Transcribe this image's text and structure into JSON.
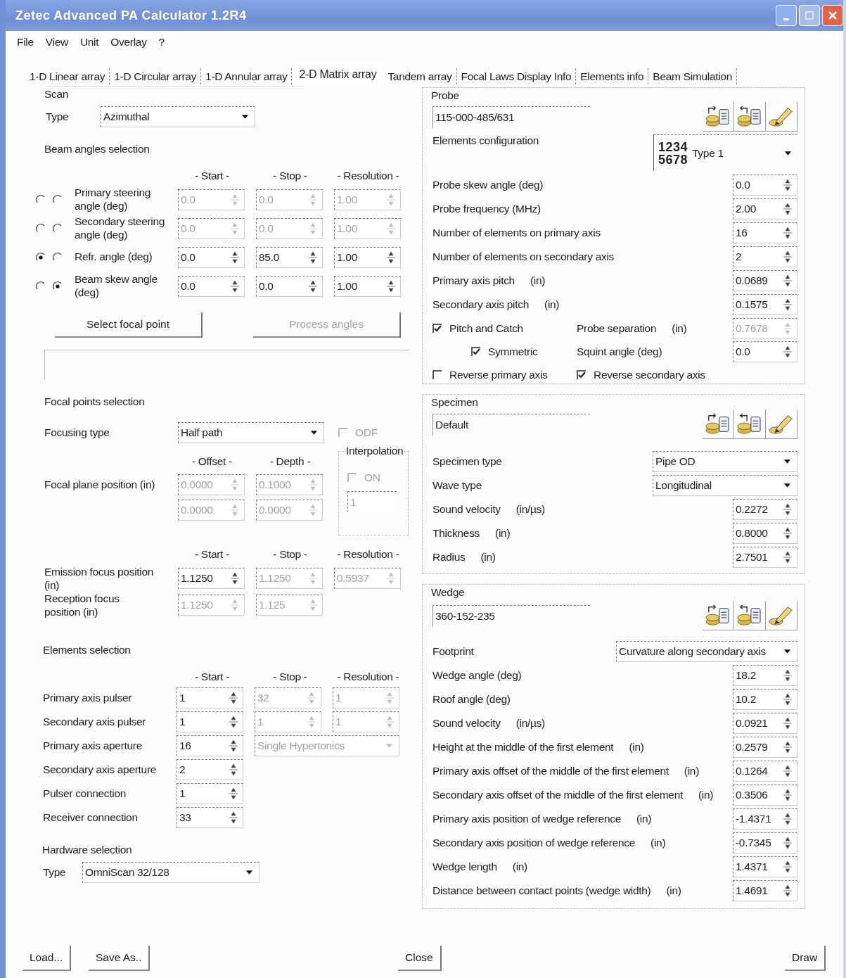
{
  "window": {
    "title": "Zetec Advanced PA Calculator 1.2R4"
  },
  "menu": [
    "File",
    "View",
    "Unit",
    "Overlay",
    "?"
  ],
  "tabs": [
    {
      "label": "1-D Linear array",
      "selected": false
    },
    {
      "label": "1-D Circular array",
      "selected": false
    },
    {
      "label": "1-D Annular array",
      "selected": false
    },
    {
      "label": "2-D Matrix array",
      "selected": true
    },
    {
      "label": "Tandem array",
      "selected": false
    },
    {
      "label": "Focal Laws Display Info",
      "selected": false
    },
    {
      "label": "Elements info",
      "selected": false
    },
    {
      "label": "Beam Simulation",
      "selected": false
    }
  ],
  "scan": {
    "title": "Scan",
    "type_label": "Type",
    "type": {
      "value": "Azimuthal",
      "disabled": false
    },
    "beam_angles_title": "Beam angles selection",
    "columns": [
      "- Start -",
      "- Stop -",
      "- Resolution -"
    ],
    "rows": [
      {
        "label": "Primary steering angle (deg)",
        "radios": [
          {
            "selected": false
          },
          {
            "selected": false
          }
        ],
        "fields": [
          {
            "value": "0.0",
            "disabled": true
          },
          {
            "value": "0.0",
            "disabled": true
          },
          {
            "value": "1.00",
            "disabled": true
          }
        ]
      },
      {
        "label": "Secondary steering angle (deg)",
        "radios": [
          {
            "selected": false
          },
          {
            "selected": false
          }
        ],
        "fields": [
          {
            "value": "0.0",
            "disabled": true
          },
          {
            "value": "0.0",
            "disabled": true
          },
          {
            "value": "1.00",
            "disabled": true
          }
        ]
      },
      {
        "label": "Refr. angle (deg)",
        "radios": [
          {
            "selected": true
          },
          {
            "selected": false
          }
        ],
        "fields": [
          {
            "value": "0.0",
            "disabled": false
          },
          {
            "value": "85.0",
            "disabled": false
          },
          {
            "value": "1.00",
            "disabled": false
          }
        ]
      },
      {
        "label": "Beam skew angle (deg)",
        "radios": [
          {
            "selected": false
          },
          {
            "selected": true
          }
        ],
        "fields": [
          {
            "value": "0.0",
            "disabled": false
          },
          {
            "value": "0.0",
            "disabled": false
          },
          {
            "value": "1.00",
            "disabled": false
          }
        ]
      }
    ],
    "buttons": [
      {
        "label": "Select focal point",
        "disabled": false
      },
      {
        "label": "Process angles",
        "disabled": true
      }
    ]
  },
  "focal": {
    "title": "Focal points selection",
    "focusing_type_label": "Focusing type",
    "focusing_type": {
      "value": "Half path",
      "disabled": false
    },
    "odf": {
      "label": "ODF",
      "checked": false,
      "disabled": true
    },
    "interpolation": {
      "title": "Interpolation",
      "on": {
        "label": "ON",
        "checked": false,
        "disabled": true
      },
      "value": {
        "value": "1",
        "disabled": true
      }
    },
    "plane_columns": [
      "- Offset -",
      "- Depth -"
    ],
    "plane_label": "Focal plane position (in)",
    "plane_rows": [
      [
        {
          "value": "0.0000",
          "disabled": true
        },
        {
          "value": "0.1000",
          "disabled": true
        }
      ],
      [
        {
          "value": "0.0000",
          "disabled": true
        },
        {
          "value": "0.0000",
          "disabled": true
        }
      ]
    ],
    "columns": [
      "- Start -",
      "- Stop -",
      "- Resolution -"
    ],
    "rows": [
      {
        "label": "Emission focus position (in)",
        "fields": [
          {
            "value": "1.1250",
            "disabled": false
          },
          {
            "value": "1.1250",
            "disabled": true
          },
          {
            "value": "0.5937",
            "disabled": true
          }
        ]
      },
      {
        "label": "Reception focus position (in)",
        "fields": [
          {
            "value": "1.1250",
            "disabled": true
          },
          {
            "value": "1.125",
            "disabled": true
          }
        ]
      }
    ]
  },
  "elements": {
    "title": "Elements selection",
    "columns": [
      "- Start -",
      "- Stop -",
      "- Resolution -"
    ],
    "rows": [
      {
        "label": "Primary axis pulser",
        "items": [
          {
            "kind": "spin",
            "value": "1",
            "disabled": false
          },
          {
            "kind": "spin",
            "value": "32",
            "disabled": true
          },
          {
            "kind": "spin",
            "value": "1",
            "disabled": true
          }
        ]
      },
      {
        "label": "Secondary axis pulser",
        "items": [
          {
            "kind": "spin",
            "value": "1",
            "disabled": false
          },
          {
            "kind": "spin",
            "value": "1",
            "disabled": true
          },
          {
            "kind": "spin",
            "value": "1",
            "disabled": true
          }
        ]
      },
      {
        "label": "Primary axis aperture",
        "items": [
          {
            "kind": "spin",
            "value": "16",
            "disabled": false
          },
          {
            "kind": "dropdown",
            "value": "Single Hypertonics",
            "disabled": true
          }
        ]
      },
      {
        "label": "Secondary axis aperture",
        "items": [
          {
            "kind": "spin",
            "value": "2",
            "disabled": false
          }
        ]
      },
      {
        "label": "Pulser connection",
        "items": [
          {
            "kind": "spin",
            "value": "1",
            "disabled": false
          }
        ]
      },
      {
        "label": "Receiver connection",
        "items": [
          {
            "kind": "spin",
            "value": "33",
            "disabled": false
          }
        ]
      }
    ]
  },
  "hardware": {
    "title": "Hardware selection",
    "type_label": "Type",
    "type": {
      "value": "OmniScan 32/128",
      "disabled": false
    }
  },
  "probe": {
    "title": "Probe",
    "name": "115-000-485/631",
    "config_label": "Elements configuration",
    "config": {
      "icon_lines": [
        "1234",
        "5678"
      ],
      "value": "Type 1"
    },
    "rows": [
      {
        "label": "Probe skew angle (deg)",
        "value": "0.0",
        "disabled": false
      },
      {
        "label": "Probe frequency (MHz)",
        "value": "2.00",
        "disabled": false
      },
      {
        "label": "Number of elements on primary axis",
        "value": "16",
        "disabled": false
      },
      {
        "label": "Number of elements on secondary axis",
        "value": "2",
        "disabled": false
      },
      {
        "label": "Primary axis pitch",
        "unit": "(in)",
        "value": "0.0689",
        "disabled": false
      },
      {
        "label": "Secondary axis pitch",
        "unit": "(in)",
        "value": "0.1575",
        "disabled": false
      }
    ],
    "pitch_catch": {
      "label": "Pitch and Catch",
      "checked": true
    },
    "separation": {
      "label": "Probe separation",
      "unit": "(in)",
      "value": "0.7678",
      "disabled": true
    },
    "symmetric": {
      "label": "Symmetric",
      "checked": true
    },
    "squint": {
      "label": "Squint angle (deg)",
      "value": "0.0",
      "disabled": false
    },
    "reverse_primary": {
      "label": "Reverse primary axis",
      "checked": false
    },
    "reverse_secondary": {
      "label": "Reverse secondary axis",
      "checked": true
    }
  },
  "specimen": {
    "title": "Specimen",
    "name": "Default",
    "rows": [
      {
        "kind": "dropdown",
        "label": "Specimen type",
        "value": "Pipe OD",
        "disabled": false
      },
      {
        "kind": "dropdown",
        "label": "Wave type",
        "value": "Longitudinal",
        "disabled": false
      },
      {
        "kind": "spin",
        "label": "Sound velocity",
        "unit": "(in/µs)",
        "value": "0.2272",
        "disabled": false
      },
      {
        "kind": "spin",
        "label": "Thickness",
        "unit": "(in)",
        "value": "0.8000",
        "disabled": false
      },
      {
        "kind": "spin",
        "label": "Radius",
        "unit": "(in)",
        "value": "2.7501",
        "disabled": false
      }
    ]
  },
  "wedge": {
    "title": "Wedge",
    "name": "360-152-235",
    "rows": [
      {
        "kind": "dropdown",
        "label": "Footprint",
        "value": "Curvature along secondary axis",
        "disabled": false
      },
      {
        "kind": "spin",
        "label": "Wedge angle (deg)",
        "value": "18.2",
        "disabled": false
      },
      {
        "kind": "spin",
        "label": "Roof angle (deg)",
        "value": "10.2",
        "disabled": false
      },
      {
        "kind": "spin",
        "label": "Sound velocity",
        "unit": "(in/µs)",
        "value": "0.0921",
        "disabled": false
      },
      {
        "kind": "spin",
        "label": "Height at the middle of the first element",
        "unit": "(in)",
        "value": "0.2579",
        "disabled": false
      },
      {
        "kind": "spin",
        "label": "Primary axis offset of the middle of the first element",
        "unit": "(in)",
        "value": "0.1264",
        "disabled": false
      },
      {
        "kind": "spin",
        "label": "Secondary axis offset of the middle of the first element",
        "unit": "(in)",
        "value": "0.3506",
        "disabled": false
      },
      {
        "kind": "spin",
        "label": "Primary axis position of wedge reference",
        "unit": "(in)",
        "value": "-1.4371",
        "disabled": false
      },
      {
        "kind": "spin",
        "label": "Secondary axis position of wedge reference",
        "unit": "(in)",
        "value": "-0.7345",
        "disabled": false
      },
      {
        "kind": "spin",
        "label": "Wedge length",
        "unit": "(in)",
        "value": "1.4371",
        "disabled": false
      },
      {
        "kind": "spin",
        "label": "Distance between contact points (wedge width)",
        "unit": "(in)",
        "value": "1.4691",
        "disabled": false
      }
    ]
  },
  "footer": [
    "Load...",
    "Save As..",
    "Close",
    "Draw"
  ]
}
